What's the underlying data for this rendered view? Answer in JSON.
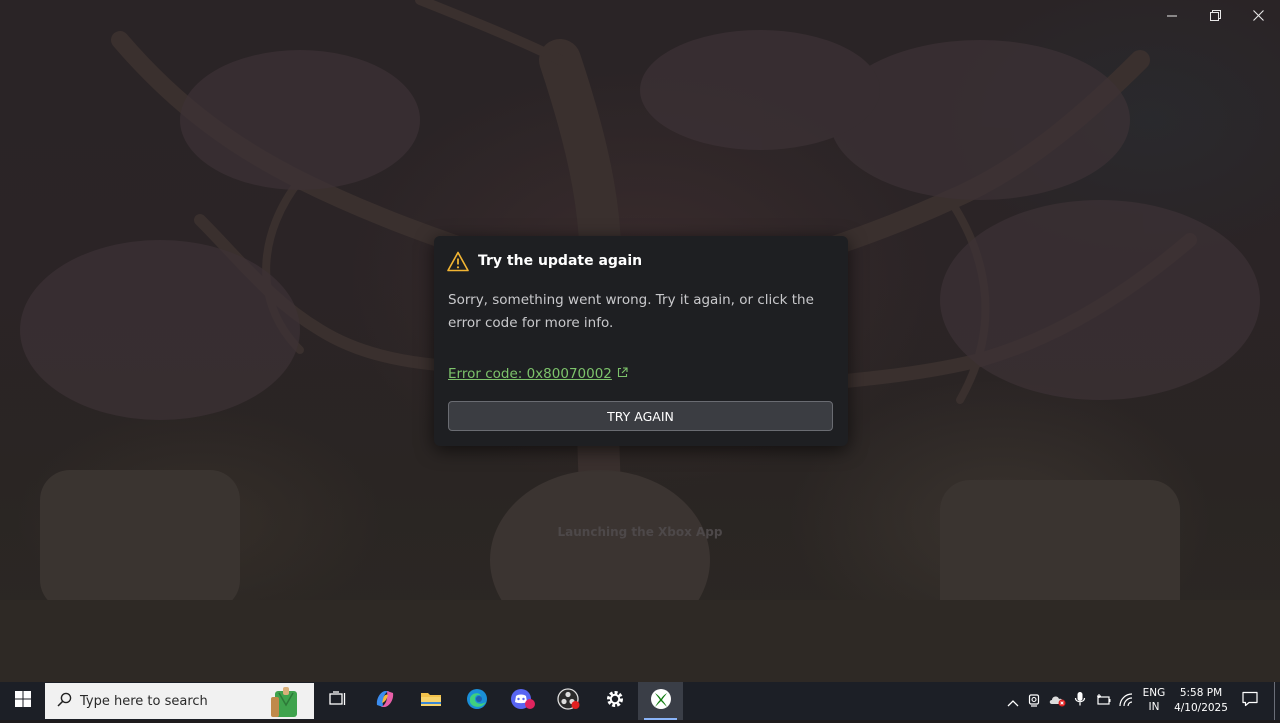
{
  "window": {
    "minimize_icon": "minimize-icon",
    "restore_icon": "restore-icon",
    "close_icon": "close-icon"
  },
  "splash": {
    "status": "Launching the Xbox App"
  },
  "dialog": {
    "title": "Try the update again",
    "message": "Sorry, something went wrong. Try it again, or click the error code for more info.",
    "error_link": "Error code: 0x80070002",
    "button": "TRY AGAIN",
    "warning_color": "#f2b533",
    "link_color": "#7dc36b"
  },
  "taskbar": {
    "search_placeholder": "Type here to search",
    "apps": [
      "task-view-icon",
      "copilot-icon",
      "file-explorer-icon",
      "edge-icon",
      "discord-icon",
      "obs-icon",
      "settings-icon",
      "xbox-icon"
    ],
    "language": "ENG",
    "region": "IN",
    "time": "5:58 PM",
    "date": "4/10/2025"
  }
}
